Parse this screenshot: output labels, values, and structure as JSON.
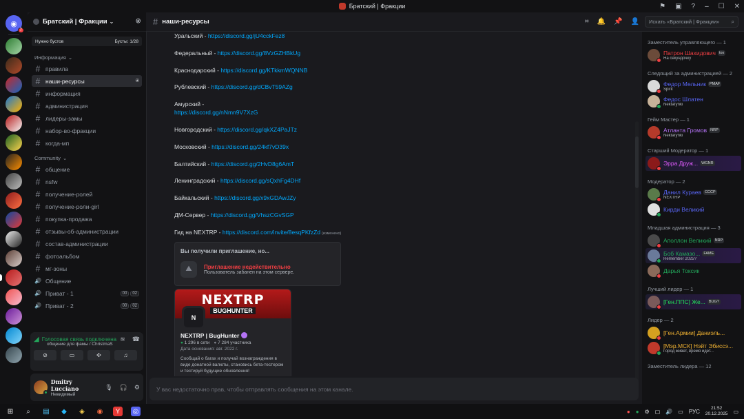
{
  "titlebar": {
    "title": "Братский | Фракции"
  },
  "server": {
    "name": "Братский | Фракции",
    "boost_left": "Нужно бустов",
    "boost_right": "Бусты: 1/28"
  },
  "guild_badge": "7",
  "sidebar": {
    "cat_info": "Информация",
    "cat_community": "Community",
    "info_channels": [
      "правила",
      "наши-ресурсы",
      "информация",
      "администрация",
      "лидеры-замы",
      "набор-во-фракции",
      "когда-мп"
    ],
    "community_channels": [
      "общение",
      "nsfw",
      "получение-ролей",
      "получение-роли-girl",
      "покупка-продажа",
      "отзывы-об-администрации",
      "состав-администрации",
      "фотоальбом",
      "мг-зоны"
    ],
    "voice_channels": [
      {
        "name": "Общение"
      },
      {
        "name": "Приват - 1",
        "a": "00",
        "b": "02"
      },
      {
        "name": "Приват - 2",
        "a": "00",
        "b": "02"
      }
    ]
  },
  "voice": {
    "status": "Голосовая связь подключена",
    "sub": "общение для фамы / ChristmaS"
  },
  "user": {
    "name": "Dmitry Lucciano",
    "status": "Невидимый"
  },
  "channel": {
    "title": "наши-ресурсы"
  },
  "search": {
    "placeholder": "Искать «Братский | Фракции»"
  },
  "messages": [
    {
      "label": "Уральский - ",
      "link": "https://discord.gg/jU4cckFez8"
    },
    {
      "label": "Федеральный - ",
      "link": "https://discord.gg/8VzGZHBkUg"
    },
    {
      "label": "Краснодарский - ",
      "link": "https://discord.gg/KTkkmWQNNB"
    },
    {
      "label": "Рублевский - ",
      "link": "https://discord.gg/dCBvT59AZg"
    },
    {
      "label": "Амурский -",
      "link": "https://discord.gg/nNmn9V7XzG",
      "break": true
    },
    {
      "label": "Новгородский - ",
      "link": "https://discord.gg/qkXZ4PaJTz"
    },
    {
      "label": "Московский - ",
      "link": "https://discord.gg/24kf7vD39x"
    },
    {
      "label": "Балтийский - ",
      "link": "https://discord.gg/2HvD8g6AmT"
    },
    {
      "label": "Ленинградский - ",
      "link": "https://discord.gg/sQxhFg4DHf"
    },
    {
      "label": "Байкальский - ",
      "link": "https://discord.gg/x9xGDAwJZy"
    },
    {
      "label": "ДМ-Сервер - ",
      "link": "https://discord.gg/VhszCGvSGP"
    },
    {
      "label": "Гид на NEXTRP - ",
      "link": "https://discord.com/invite/8esqPKfzZd",
      "edited": "(изменено)"
    }
  ],
  "invite": {
    "header": "Вы получили приглашение, но...",
    "error": "Приглашение недействительно",
    "sub": "Пользователь забанен на этом сервере."
  },
  "server_card": {
    "banner_title": "NEXTRP",
    "banner_sub": "BUGHUNTER",
    "name": "NEXTRP | BugHunter",
    "online": "1 296 в сети",
    "members": "7 284 участника",
    "founded": "Дата основания: авг. 2022 г.",
    "desc": "Сообщай о багах и получай вознаграждения в виде донатной валюты, становись бета-тестером и тестируй будущие обновления!"
  },
  "composer": {
    "placeholder": "У вас недостаточно прав, чтобы отправлять сообщения на этом канале."
  },
  "members": [
    {
      "role": "Заместитель управляющего — 1",
      "list": [
        {
          "name": "Патрон Шахидович",
          "tag": "tox",
          "sub": "На секундочку",
          "color": "#f23f43",
          "av": "#6b4b3a"
        }
      ]
    },
    {
      "role": "Следящий за администрацией — 2",
      "list": [
        {
          "name": "Федор Мельник",
          "tag": "PMAF",
          "sub": "Spirit",
          "color": "#5865f2",
          "av": "#d9d9d9"
        },
        {
          "name": "Федос Шлатен",
          "tag": "",
          "sub": "Nektarynki",
          "color": "#5865f2",
          "av": "#c7b299"
        }
      ]
    },
    {
      "role": "Гейм Мастер — 1",
      "list": [
        {
          "name": "Атланта Громов",
          "tag": "NRP",
          "sub": "Nektarynki",
          "color": "#b473f5",
          "av": "#b53a2a"
        }
      ]
    },
    {
      "role": "Старший Модератор — 1",
      "list": [
        {
          "name": "Эрра Друж...",
          "tag": "WGNR",
          "sub": "",
          "color": "#e05cff",
          "av": "#8b1a1a",
          "hl": true
        }
      ]
    },
    {
      "role": "Модератор — 2",
      "list": [
        {
          "name": "Данил Кураев",
          "tag": "CCCP",
          "sub": "NEXTRP",
          "color": "#5865f2",
          "av": "#5a7a4a"
        },
        {
          "name": "Кирди Великий",
          "tag": "",
          "sub": "",
          "color": "#5865f2",
          "av": "#e0e0e0"
        }
      ]
    },
    {
      "role": "Младшая администрация — 3",
      "list": [
        {
          "name": "Аполлон Великий",
          "tag": "NRP",
          "sub": "",
          "color": "#23a55a",
          "av": "#4a4a4a"
        },
        {
          "name": "Боб Камазо...",
          "tag": "FAME",
          "sub": "Remember 2025?",
          "color": "#23a55a",
          "av": "#6a7a9a",
          "hl": true
        },
        {
          "name": "Дарья Токсик",
          "tag": "",
          "sub": "",
          "color": "#23a55a",
          "av": "#8a6a5a"
        }
      ]
    },
    {
      "role": "Лучший лидер — 1",
      "list": [
        {
          "name": "[Ген.ППС] Же...",
          "tag": "BUG?",
          "sub": "",
          "color": "#23e55a",
          "av": "#7a5a5a",
          "hl": true
        }
      ]
    },
    {
      "role": "Лидер — 2",
      "list": [
        {
          "name": "[Ген.Армии] Даниэль...",
          "tag": "",
          "sub": "",
          "color": "#f0b232",
          "av": "#d4a020"
        },
        {
          "name": "[Мэр.МСК] Нэйт Эбиссэ...",
          "tag": "",
          "sub": "Город живет, время идет...",
          "color": "#f0b232",
          "av": "#c0392b"
        }
      ]
    },
    {
      "role": "Заместитель лидера — 12",
      "list": []
    }
  ],
  "taskbar": {
    "lang": "РУС",
    "time": "21:52",
    "date": "20.12.2025"
  }
}
